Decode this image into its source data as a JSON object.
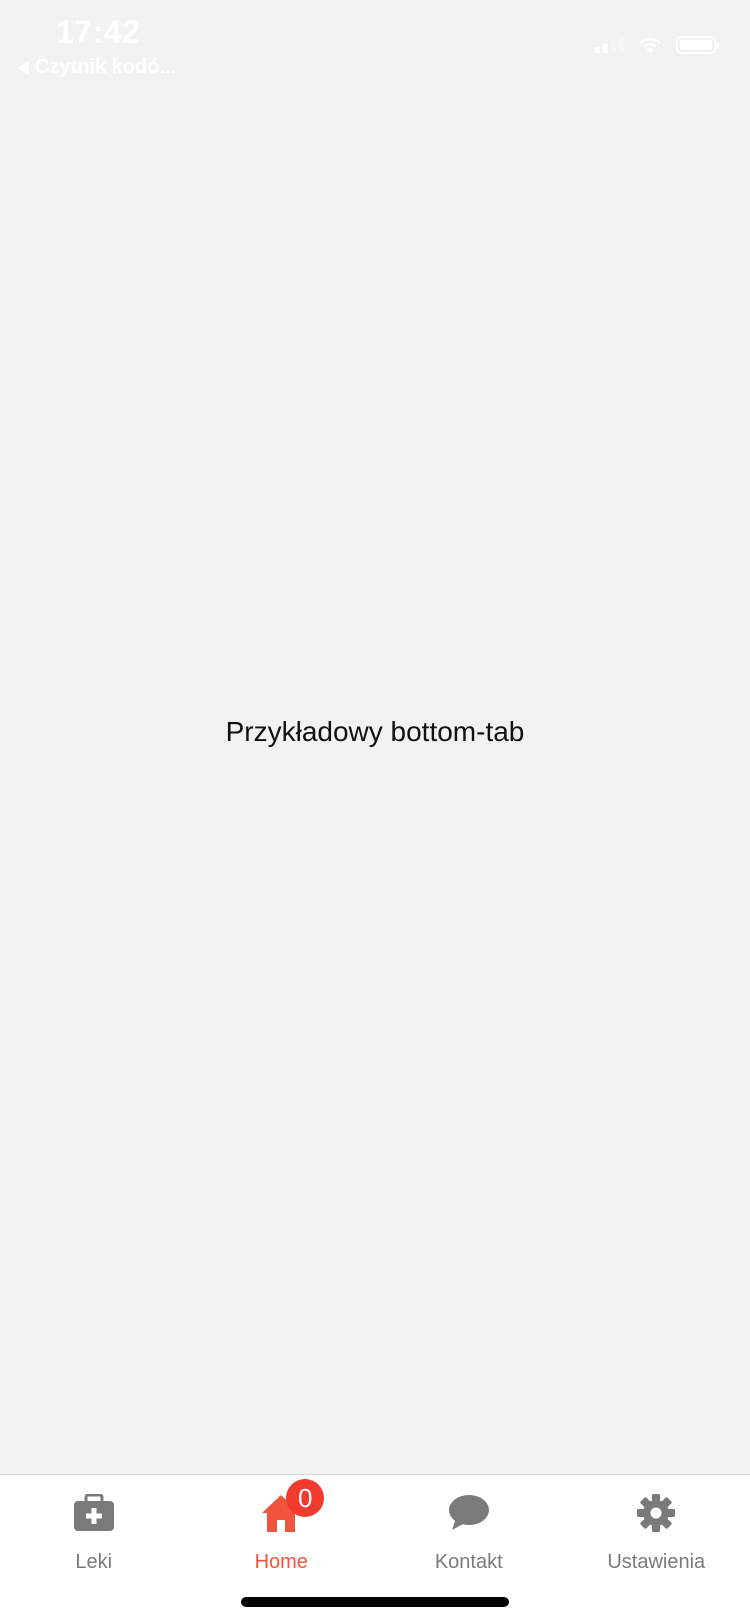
{
  "status_bar": {
    "time": "17:42",
    "back_app_label": "Czytnik kodó..."
  },
  "main": {
    "text": "Przykładowy bottom-tab"
  },
  "tab_bar": {
    "tabs": [
      {
        "label": "Leki",
        "icon": "medical-kit-icon",
        "active": false
      },
      {
        "label": "Home",
        "icon": "home-icon",
        "active": true,
        "badge": "0"
      },
      {
        "label": "Kontakt",
        "icon": "chat-bubble-icon",
        "active": false
      },
      {
        "label": "Ustawienia",
        "icon": "gear-icon",
        "active": false
      }
    ]
  },
  "colors": {
    "background": "#f2f2f2",
    "active_tab": "#f2553d",
    "inactive_tab": "#7a7a7a",
    "badge": "#f23a2f"
  }
}
